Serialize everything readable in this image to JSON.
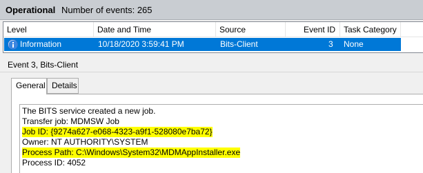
{
  "header": {
    "log_name": "Operational",
    "event_count": "Number of events: 265"
  },
  "columns": [
    "Level",
    "Date and Time",
    "Source",
    "Event ID",
    "Task Category"
  ],
  "selected_row": {
    "level": "Information",
    "date_time": "10/18/2020 3:59:41 PM",
    "source": "Bits-Client",
    "event_id": "3",
    "task_category": "None",
    "level_icon": "info-icon",
    "selection_color": "#0078d7"
  },
  "detail": {
    "title": "Event 3, Bits-Client",
    "tabs": [
      "General",
      "Details"
    ],
    "active_tab": "General",
    "highlight_color": "#ffff00",
    "lines": [
      "The BITS service created a new job.",
      "Transfer job: MDMSW Job",
      "Job ID: {9274a627-e068-4323-a9f1-528080e7ba72}",
      "Owner: NT AUTHORITY\\SYSTEM",
      "Process Path: C:\\Windows\\System32\\MDMAppInstaller.exe",
      "Process ID: 4052"
    ]
  }
}
